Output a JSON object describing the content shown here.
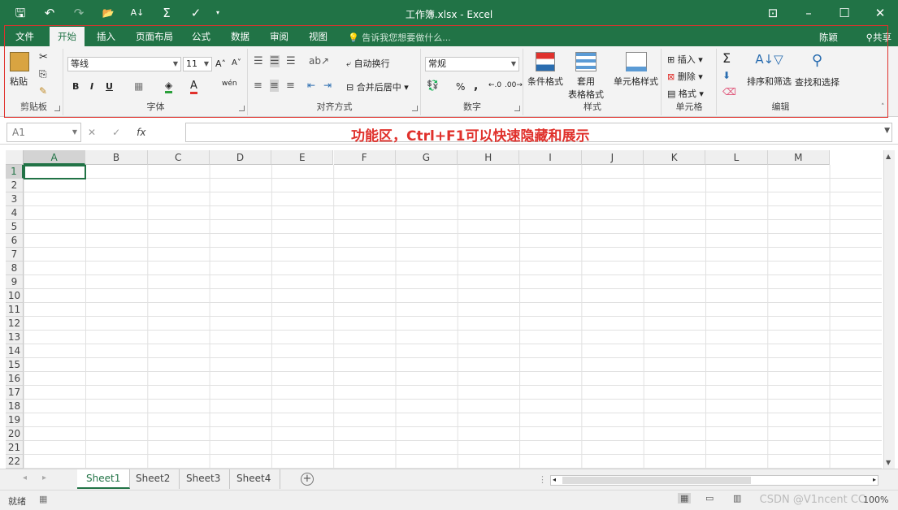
{
  "window": {
    "title": "工作簿.xlsx - Excel"
  },
  "qat": {
    "save": "🖫",
    "undo": "↶",
    "redo": "↷",
    "open": "📂",
    "sort": "A↓",
    "sum": "Σ",
    "format": "✓",
    "more": "▾"
  },
  "window_controls": {
    "restore_ribbon": "⊡",
    "minimize": "–",
    "maximize": "☐",
    "close": "✕"
  },
  "tabs": [
    {
      "label": "文件"
    },
    {
      "label": "开始"
    },
    {
      "label": "插入"
    },
    {
      "label": "页面布局"
    },
    {
      "label": "公式"
    },
    {
      "label": "数据"
    },
    {
      "label": "审阅"
    },
    {
      "label": "视图"
    }
  ],
  "active_tab": "开始",
  "tell_me": "告诉我您想要做什么...",
  "user": "陈颖",
  "share": "共享",
  "ribbon": {
    "clipboard": {
      "label": "剪贴板",
      "paste": "粘贴"
    },
    "font": {
      "label": "字体",
      "font_name": "等线",
      "font_size": "11",
      "bold": "B",
      "italic": "I",
      "underline": "U",
      "grow": "A˄",
      "shrink": "A˅",
      "phonetic": "wén"
    },
    "alignment": {
      "label": "对齐方式",
      "wrap": "自动换行",
      "merge": "合并后居中"
    },
    "number": {
      "label": "数字",
      "format": "常规",
      "percent": "%",
      "comma": ","
    },
    "styles": {
      "label": "样式",
      "conditional": "条件格式",
      "table": "套用\n表格格式",
      "table1": "套用",
      "table2": "表格格式",
      "cell_styles": "单元格样式"
    },
    "cells": {
      "label": "单元格",
      "insert": "插入",
      "delete": "删除",
      "format": "格式"
    },
    "editing": {
      "label": "编辑",
      "sort_filter": "排序和筛选",
      "find_select": "查找和选择",
      "sum": "Σ"
    }
  },
  "name_box": "A1",
  "fx": "fx",
  "annotation": "功能区，Ctrl+F1可以快速隐藏和展示",
  "columns": [
    "A",
    "B",
    "C",
    "D",
    "E",
    "F",
    "G",
    "H",
    "I",
    "J",
    "K",
    "L",
    "M"
  ],
  "rows": [
    "1",
    "2",
    "3",
    "4",
    "5",
    "6",
    "7",
    "8",
    "9",
    "10",
    "11",
    "12",
    "13",
    "14",
    "15",
    "16",
    "17",
    "18",
    "19",
    "20",
    "21",
    "22"
  ],
  "sheets": [
    {
      "label": "Sheet1"
    },
    {
      "label": "Sheet2"
    },
    {
      "label": "Sheet3"
    },
    {
      "label": "Sheet4"
    }
  ],
  "active_sheet": "Sheet1",
  "status": {
    "ready": "就绪",
    "zoom": "100%"
  },
  "watermark": "CSDN @V1ncent CC",
  "colors": {
    "accent": "#217346",
    "annotation": "#e0312c"
  }
}
